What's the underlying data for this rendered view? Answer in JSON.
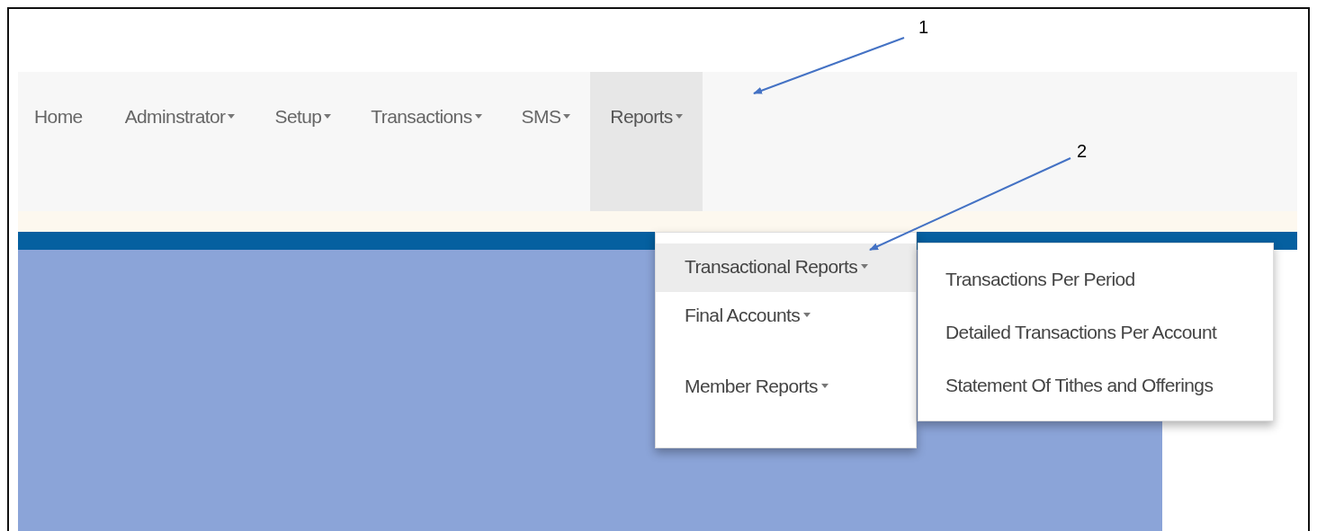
{
  "navbar": {
    "items": [
      {
        "label": "Home",
        "dropdown": false,
        "selected": false
      },
      {
        "label": "Adminstrator",
        "dropdown": true,
        "selected": false
      },
      {
        "label": "Setup",
        "dropdown": true,
        "selected": false
      },
      {
        "label": "Transactions",
        "dropdown": true,
        "selected": false
      },
      {
        "label": "SMS",
        "dropdown": true,
        "selected": false
      },
      {
        "label": "Reports",
        "dropdown": true,
        "selected": true
      }
    ]
  },
  "reports_menu": {
    "items": [
      {
        "label": "Transactional Reports",
        "dropdown": true,
        "selected": true
      },
      {
        "label": "Final Accounts",
        "dropdown": true,
        "selected": false
      },
      {
        "label": "Member Reports",
        "dropdown": true,
        "selected": false
      }
    ]
  },
  "submenu": {
    "items": [
      {
        "label": "Transactions Per Period"
      },
      {
        "label": "Detailed Transactions Per Account"
      },
      {
        "label": "Statement Of Tithes and Offerings"
      }
    ]
  },
  "annotations": [
    {
      "label": "1"
    },
    {
      "label": "2"
    }
  ]
}
